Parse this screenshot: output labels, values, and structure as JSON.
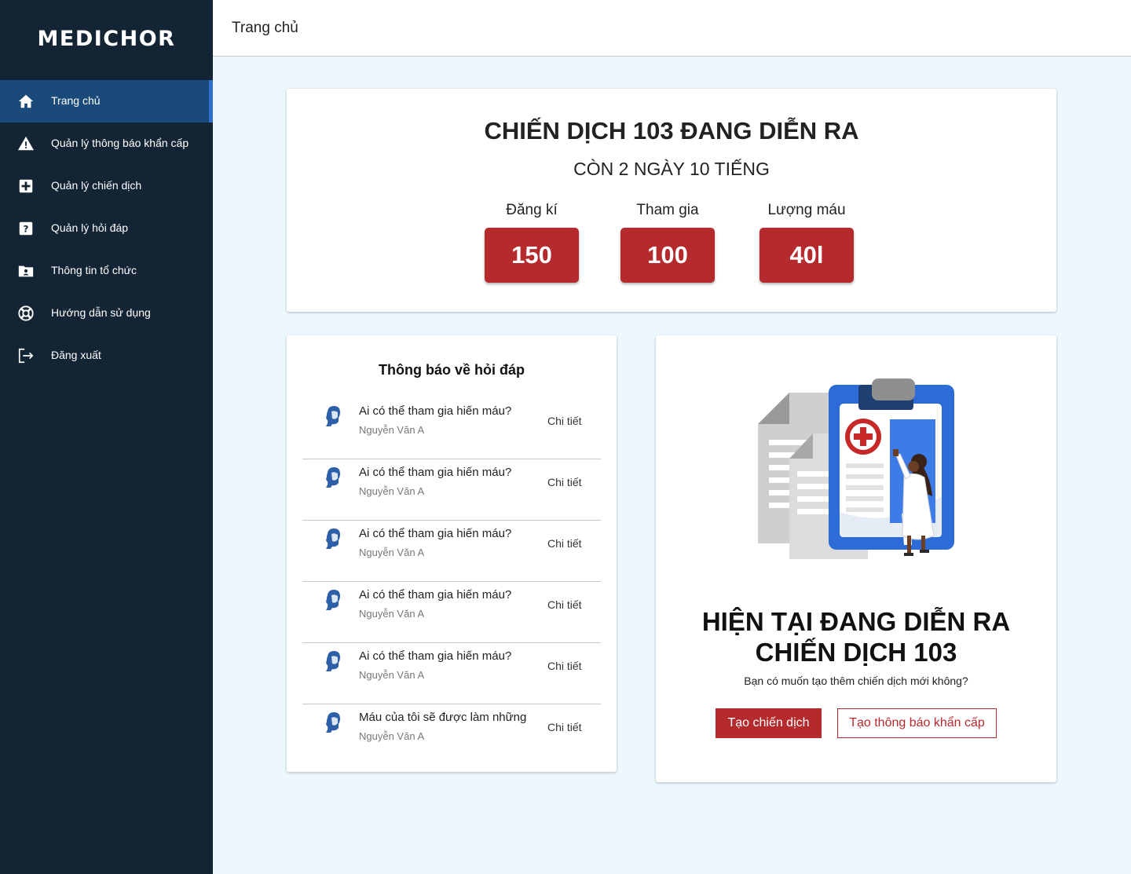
{
  "app": {
    "logo": "MEDICHOR"
  },
  "header": {
    "title": "Trang chủ"
  },
  "sidebar": {
    "items": [
      {
        "label": "Trang chủ",
        "icon": "home-icon",
        "active": true
      },
      {
        "label": "Quản lý thông báo khẩn cấp",
        "icon": "warning-icon"
      },
      {
        "label": "Quản lý chiến dịch",
        "icon": "medical-plus-icon"
      },
      {
        "label": "Quản lý hỏi đáp",
        "icon": "question-icon"
      },
      {
        "label": "Thông tin tổ chức",
        "icon": "folder-user-icon"
      },
      {
        "label": "Hướng dẫn sử dụng",
        "icon": "lifebuoy-icon"
      },
      {
        "label": "Đăng xuất",
        "icon": "logout-icon"
      }
    ]
  },
  "campaign": {
    "title": "CHIẾN DỊCH 103 ĐANG DIỄN RA",
    "remaining": "CÒN 2 NGÀY 10 TIẾNG",
    "stats": [
      {
        "label": "Đăng kí",
        "value": "150"
      },
      {
        "label": "Tham gia",
        "value": "100"
      },
      {
        "label": "Lượng máu",
        "value": "40l"
      }
    ]
  },
  "qa": {
    "title": "Thông báo về hỏi đáp",
    "detail_label": "Chi tiết",
    "items": [
      {
        "question": "Ai có thể tham gia hiến máu?",
        "author": "Nguyễn Văn A"
      },
      {
        "question": "Ai có thể tham gia hiến máu?",
        "author": "Nguyễn Văn A"
      },
      {
        "question": "Ai có thể tham gia hiến máu?",
        "author": "Nguyễn Văn A"
      },
      {
        "question": "Ai có thể tham gia hiến máu?",
        "author": "Nguyễn Văn A"
      },
      {
        "question": "Ai có thể tham gia hiến máu?",
        "author": "Nguyễn Văn A"
      },
      {
        "question": "Máu của tôi sẽ được làm những",
        "author": "Nguyễn Văn A"
      }
    ]
  },
  "promo": {
    "title_line1": "HIỆN TẠI ĐANG DIỄN RA",
    "title_line2": "CHIẾN DỊCH 103",
    "subtitle": "Bạn có muốn tạo thêm chiến dịch mới không?",
    "primary_button": "Tạo chiến dịch",
    "secondary_button": "Tạo thông báo khẩn cấp"
  },
  "colors": {
    "sidebar": "#132434",
    "active": "#1a4a7a",
    "accent": "#b52a2d",
    "background": "#ecf8fd"
  }
}
